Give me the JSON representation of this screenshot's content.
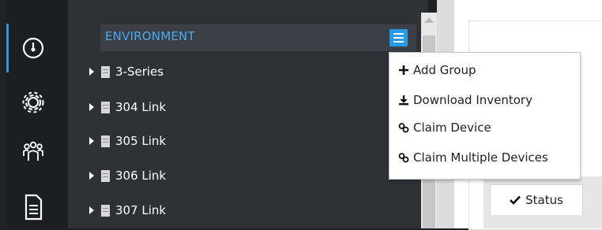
{
  "nav_rail": {
    "items": [
      {
        "name": "dashboard-gauge-icon",
        "active": true
      },
      {
        "name": "settings-gear-icon",
        "active": false
      },
      {
        "name": "users-group-icon",
        "active": false
      },
      {
        "name": "reports-document-icon",
        "active": false
      }
    ],
    "active_color": "#3a8fd6"
  },
  "tree": {
    "header": {
      "title": "ENVIRONMENT",
      "menu_icon": "hamburger-menu-icon"
    },
    "items": [
      {
        "label": "3-Series"
      },
      {
        "label": "304 Link"
      },
      {
        "label": "305 Link"
      },
      {
        "label": "306 Link"
      },
      {
        "label": "307 Link"
      }
    ]
  },
  "menu": {
    "items": [
      {
        "label": "Add Group",
        "icon": "plus-icon"
      },
      {
        "label": "Download Inventory",
        "icon": "download-icon"
      },
      {
        "label": "Claim Device",
        "icon": "link-icon"
      },
      {
        "label": "Claim Multiple Devices",
        "icon": "link-icon"
      }
    ]
  },
  "details": {
    "tabs": [
      {
        "label": "Status",
        "icon": "checkmark-icon",
        "active": true
      }
    ]
  },
  "colors": {
    "accent": "#2a9ae8",
    "header_text": "#4aa8f0",
    "tree_bg": "#2d3237"
  }
}
